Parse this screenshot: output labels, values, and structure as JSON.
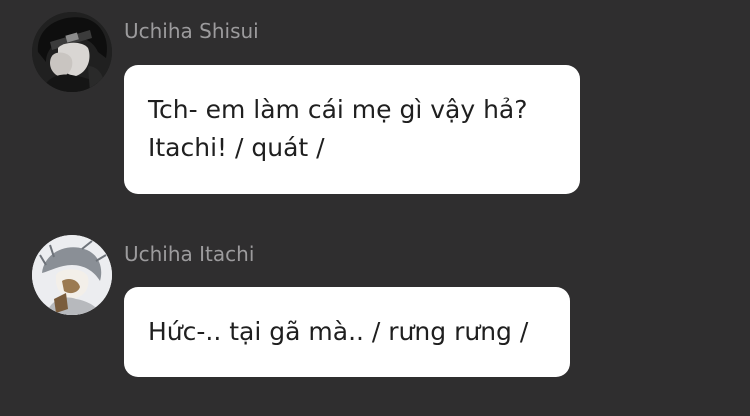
{
  "messages": [
    {
      "sender": "Uchiha Shisui",
      "avatar_icon": "user-avatar-dark",
      "lines": [
        "Tch- em làm cái mẹ gì vậy hả?",
        "Itachi! / quát /"
      ]
    },
    {
      "sender": "Uchiha Itachi",
      "avatar_icon": "user-avatar-light",
      "lines": [
        "Hức-.. tại gã mà.. / rưng rưng /"
      ]
    }
  ],
  "colors": {
    "background": "#2f2e2f",
    "bubble": "#ffffff",
    "sender_name": "#9c9b9d",
    "message_text": "#1f1f1f"
  }
}
